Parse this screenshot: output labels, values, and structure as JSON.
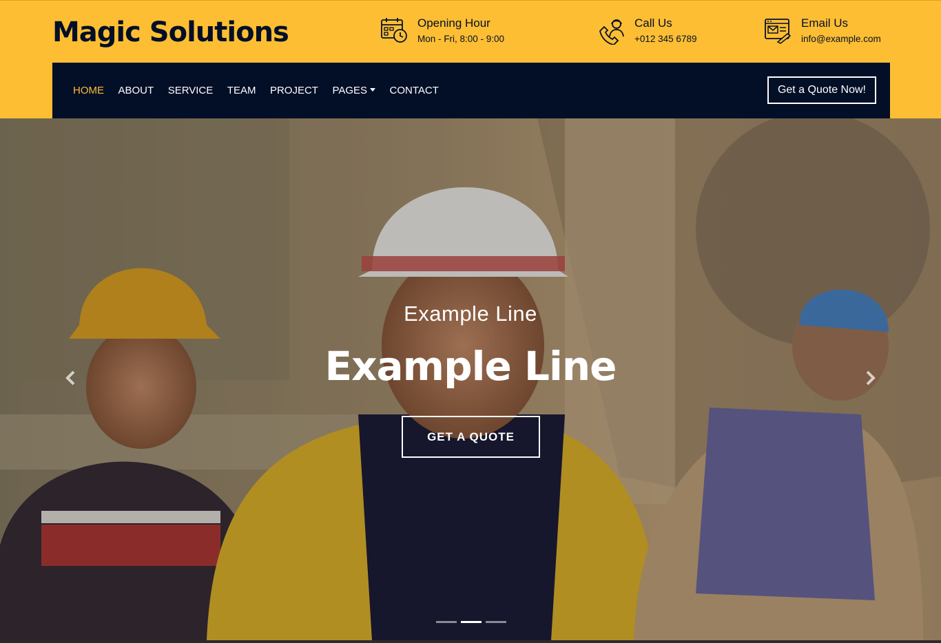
{
  "brand": {
    "name": "Magic Solutions"
  },
  "info": {
    "hours": {
      "title": "Opening Hour",
      "value": "Mon - Fri, 8:00 - 9:00"
    },
    "call": {
      "title": "Call Us",
      "value": "+012 345 6789"
    },
    "email": {
      "title": "Email Us",
      "value": "info@example.com"
    }
  },
  "nav": {
    "items": [
      {
        "label": "HOME",
        "active": true
      },
      {
        "label": "ABOUT"
      },
      {
        "label": "SERVICE"
      },
      {
        "label": "TEAM"
      },
      {
        "label": "PROJECT"
      },
      {
        "label": "PAGES"
      },
      {
        "label": "CONTACT"
      }
    ],
    "quote_button": "Get a Quote Now!"
  },
  "hero": {
    "subtitle": "Example Line",
    "title": "Example Line",
    "cta": "GET A QUOTE",
    "active_slide": 2,
    "slide_count": 3
  },
  "colors": {
    "accent": "#FDBE33",
    "navy": "#030F27",
    "white": "#FFFFFF"
  }
}
